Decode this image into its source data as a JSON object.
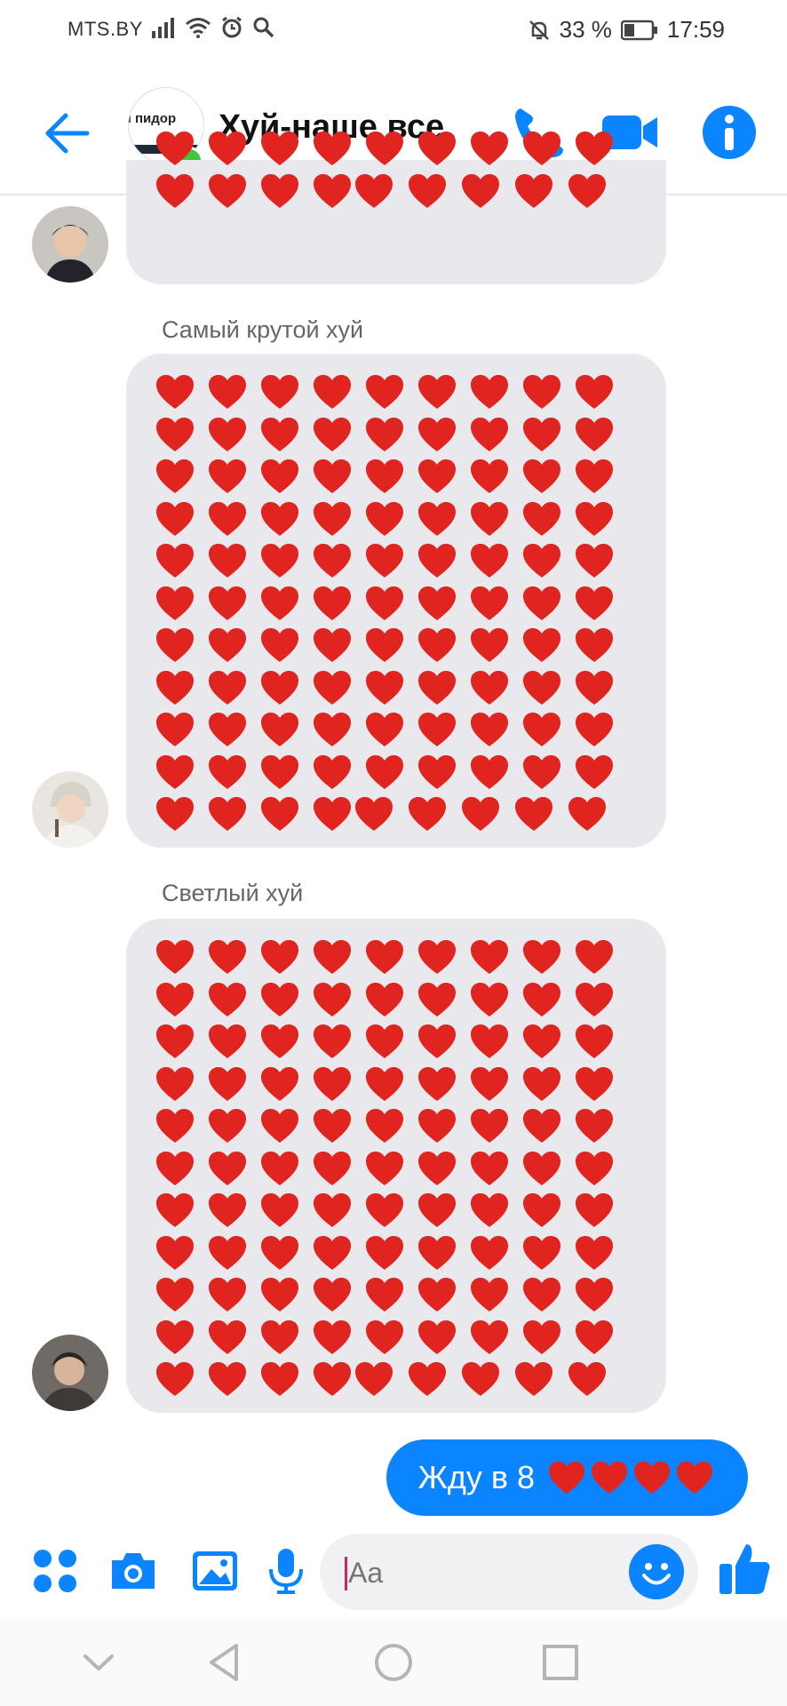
{
  "status_bar": {
    "carrier": "MTS.BY",
    "battery": "33 %",
    "time": "17:59"
  },
  "header": {
    "avatar_text": "ы пидор",
    "title": "Хуй-наше все",
    "icons": [
      "back-arrow-icon",
      "phone-icon",
      "video-camera-icon",
      "info-icon"
    ]
  },
  "messages": [
    {
      "sender": "",
      "type": "hearts",
      "rows_visible": 2,
      "per_row": 9
    },
    {
      "sender": "Самый крутой хуй",
      "type": "hearts",
      "rows": 11,
      "per_row": 9
    },
    {
      "sender": "Светлый хуй",
      "type": "hearts",
      "rows": 11,
      "per_row": 9
    }
  ],
  "own_message": {
    "text": "Жду в 8",
    "hearts": 4
  },
  "composer": {
    "placeholder": "Aa"
  },
  "colors": {
    "accent": "#0a84ff",
    "heart": "#e0241f",
    "bubble": "#e9e8ec",
    "online": "#3ec73e"
  }
}
